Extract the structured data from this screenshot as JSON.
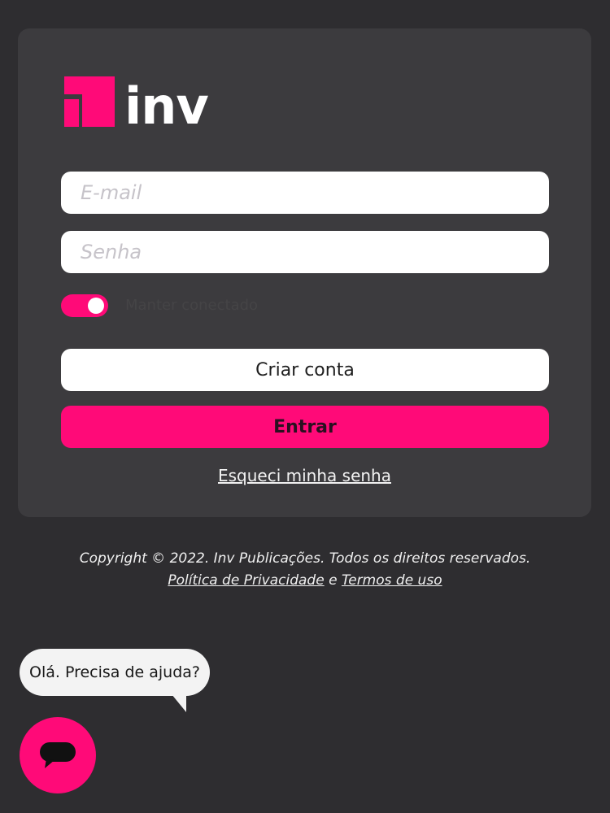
{
  "brand": {
    "name": "inv",
    "accent_color": "#ff0a78"
  },
  "login": {
    "email_placeholder": "E-mail",
    "password_placeholder": "Senha",
    "remember_label": "Manter conectado",
    "remember_on": true,
    "create_account_label": "Criar conta",
    "login_label": "Entrar",
    "forgot_password_label": "Esqueci minha senha"
  },
  "footer": {
    "copyright": "Copyright © 2022. Inv Publicações. Todos os direitos reservados.",
    "privacy_label": "Política de Privacidade",
    "and_label": "e",
    "terms_label": "Termos de uso"
  },
  "chat": {
    "bubble_text": "Olá. Precisa de ajuda?",
    "icon": "chat-bubble-icon"
  }
}
